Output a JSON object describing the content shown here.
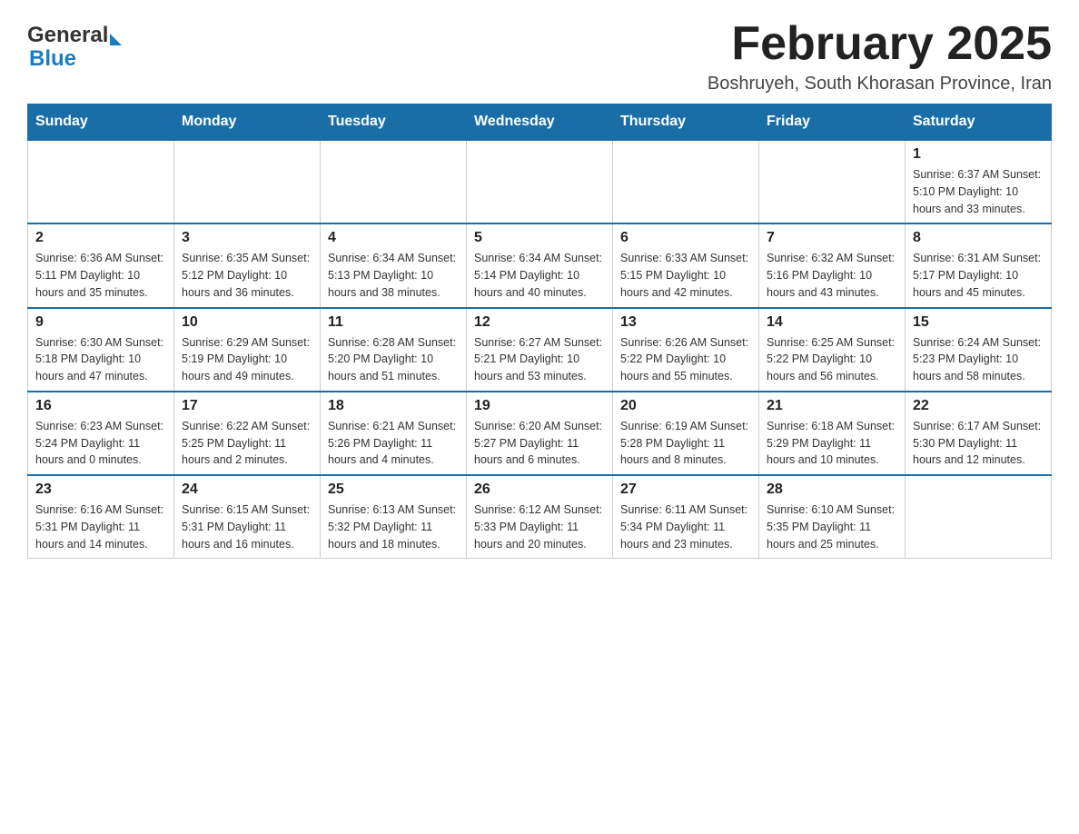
{
  "header": {
    "logo_general": "General",
    "logo_blue": "Blue",
    "title": "February 2025",
    "location": "Boshruyeh, South Khorasan Province, Iran"
  },
  "calendar": {
    "days_of_week": [
      "Sunday",
      "Monday",
      "Tuesday",
      "Wednesday",
      "Thursday",
      "Friday",
      "Saturday"
    ],
    "weeks": [
      [
        {
          "day": "",
          "info": ""
        },
        {
          "day": "",
          "info": ""
        },
        {
          "day": "",
          "info": ""
        },
        {
          "day": "",
          "info": ""
        },
        {
          "day": "",
          "info": ""
        },
        {
          "day": "",
          "info": ""
        },
        {
          "day": "1",
          "info": "Sunrise: 6:37 AM\nSunset: 5:10 PM\nDaylight: 10 hours and 33 minutes."
        }
      ],
      [
        {
          "day": "2",
          "info": "Sunrise: 6:36 AM\nSunset: 5:11 PM\nDaylight: 10 hours and 35 minutes."
        },
        {
          "day": "3",
          "info": "Sunrise: 6:35 AM\nSunset: 5:12 PM\nDaylight: 10 hours and 36 minutes."
        },
        {
          "day": "4",
          "info": "Sunrise: 6:34 AM\nSunset: 5:13 PM\nDaylight: 10 hours and 38 minutes."
        },
        {
          "day": "5",
          "info": "Sunrise: 6:34 AM\nSunset: 5:14 PM\nDaylight: 10 hours and 40 minutes."
        },
        {
          "day": "6",
          "info": "Sunrise: 6:33 AM\nSunset: 5:15 PM\nDaylight: 10 hours and 42 minutes."
        },
        {
          "day": "7",
          "info": "Sunrise: 6:32 AM\nSunset: 5:16 PM\nDaylight: 10 hours and 43 minutes."
        },
        {
          "day": "8",
          "info": "Sunrise: 6:31 AM\nSunset: 5:17 PM\nDaylight: 10 hours and 45 minutes."
        }
      ],
      [
        {
          "day": "9",
          "info": "Sunrise: 6:30 AM\nSunset: 5:18 PM\nDaylight: 10 hours and 47 minutes."
        },
        {
          "day": "10",
          "info": "Sunrise: 6:29 AM\nSunset: 5:19 PM\nDaylight: 10 hours and 49 minutes."
        },
        {
          "day": "11",
          "info": "Sunrise: 6:28 AM\nSunset: 5:20 PM\nDaylight: 10 hours and 51 minutes."
        },
        {
          "day": "12",
          "info": "Sunrise: 6:27 AM\nSunset: 5:21 PM\nDaylight: 10 hours and 53 minutes."
        },
        {
          "day": "13",
          "info": "Sunrise: 6:26 AM\nSunset: 5:22 PM\nDaylight: 10 hours and 55 minutes."
        },
        {
          "day": "14",
          "info": "Sunrise: 6:25 AM\nSunset: 5:22 PM\nDaylight: 10 hours and 56 minutes."
        },
        {
          "day": "15",
          "info": "Sunrise: 6:24 AM\nSunset: 5:23 PM\nDaylight: 10 hours and 58 minutes."
        }
      ],
      [
        {
          "day": "16",
          "info": "Sunrise: 6:23 AM\nSunset: 5:24 PM\nDaylight: 11 hours and 0 minutes."
        },
        {
          "day": "17",
          "info": "Sunrise: 6:22 AM\nSunset: 5:25 PM\nDaylight: 11 hours and 2 minutes."
        },
        {
          "day": "18",
          "info": "Sunrise: 6:21 AM\nSunset: 5:26 PM\nDaylight: 11 hours and 4 minutes."
        },
        {
          "day": "19",
          "info": "Sunrise: 6:20 AM\nSunset: 5:27 PM\nDaylight: 11 hours and 6 minutes."
        },
        {
          "day": "20",
          "info": "Sunrise: 6:19 AM\nSunset: 5:28 PM\nDaylight: 11 hours and 8 minutes."
        },
        {
          "day": "21",
          "info": "Sunrise: 6:18 AM\nSunset: 5:29 PM\nDaylight: 11 hours and 10 minutes."
        },
        {
          "day": "22",
          "info": "Sunrise: 6:17 AM\nSunset: 5:30 PM\nDaylight: 11 hours and 12 minutes."
        }
      ],
      [
        {
          "day": "23",
          "info": "Sunrise: 6:16 AM\nSunset: 5:31 PM\nDaylight: 11 hours and 14 minutes."
        },
        {
          "day": "24",
          "info": "Sunrise: 6:15 AM\nSunset: 5:31 PM\nDaylight: 11 hours and 16 minutes."
        },
        {
          "day": "25",
          "info": "Sunrise: 6:13 AM\nSunset: 5:32 PM\nDaylight: 11 hours and 18 minutes."
        },
        {
          "day": "26",
          "info": "Sunrise: 6:12 AM\nSunset: 5:33 PM\nDaylight: 11 hours and 20 minutes."
        },
        {
          "day": "27",
          "info": "Sunrise: 6:11 AM\nSunset: 5:34 PM\nDaylight: 11 hours and 23 minutes."
        },
        {
          "day": "28",
          "info": "Sunrise: 6:10 AM\nSunset: 5:35 PM\nDaylight: 11 hours and 25 minutes."
        },
        {
          "day": "",
          "info": ""
        }
      ]
    ]
  }
}
